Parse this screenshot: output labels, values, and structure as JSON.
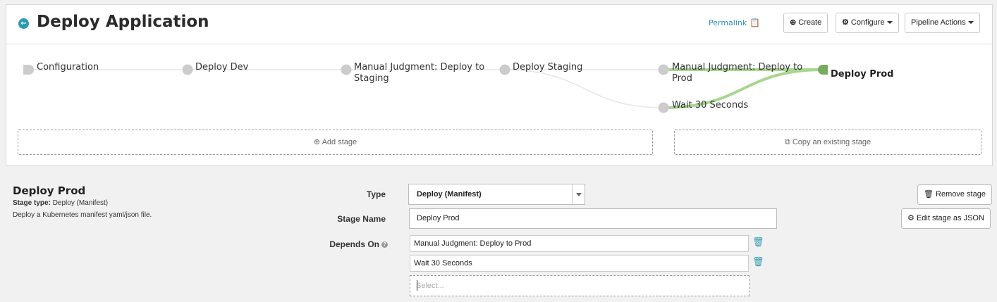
{
  "header": {
    "title": "Deploy Application",
    "permalink": "Permalink",
    "create_label": "Create",
    "configure_label": "Configure",
    "pipeline_actions_label": "Pipeline Actions"
  },
  "graph": {
    "nodes": [
      {
        "label": "Configuration"
      },
      {
        "label": "Deploy Dev"
      },
      {
        "label_line1": "Manual Judgment: Deploy to",
        "label_line2": "Staging"
      },
      {
        "label": "Deploy Staging"
      },
      {
        "label_line1": "Manual Judgment: Deploy to",
        "label_line2": "Prod"
      },
      {
        "label": "Wait 30 Seconds"
      },
      {
        "label": "Deploy Prod",
        "active": true
      }
    ],
    "add_stage": "Add stage",
    "copy_stage": "Copy an existing stage",
    "colors": {
      "edge": "#e6e6e6",
      "highlight": "#a8d690",
      "active_node": "#7aaa5c",
      "node": "#cccccc"
    }
  },
  "stage": {
    "title": "Deploy Prod",
    "type_prefix": "Stage type:",
    "type_value": "Deploy (Manifest)",
    "description": "Deploy a Kubernetes manifest yaml/json file."
  },
  "form": {
    "type_label": "Type",
    "type_value": "Deploy (Manifest)",
    "stage_name_label": "Stage Name",
    "stage_name_value": "Deploy Prod",
    "depends_on_label": "Depends On",
    "depends_on": [
      "Manual Judgment: Deploy to Prod",
      "Wait 30 Seconds"
    ],
    "select_placeholder": "Select..."
  },
  "actions": {
    "remove_stage": "Remove stage",
    "edit_json": "Edit stage as JSON"
  }
}
